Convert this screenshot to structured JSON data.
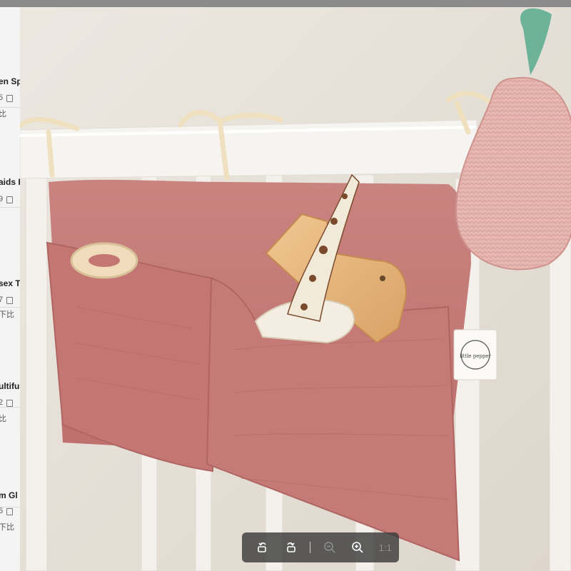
{
  "background_list": {
    "rows": [
      {
        "title": "en Sp",
        "number": "5",
        "compare": "比"
      },
      {
        "title": "aids H",
        "number": "9",
        "compare": "比"
      },
      {
        "title": "sex Tv",
        "number": "7",
        "compare": "下比"
      },
      {
        "title": "ultifu",
        "number": "2",
        "compare": "比"
      },
      {
        "title": "m Gl",
        "number": "5",
        "compare": "下比"
      }
    ]
  },
  "viewer": {
    "image_subject": "crib-hanging-storage-bag",
    "label_tag_text": "little pepper",
    "toolbar": {
      "rotate_left_icon": "rotate-left-icon",
      "rotate_right_icon": "rotate-right-icon",
      "zoom_out_icon": "zoom-out-icon",
      "zoom_in_icon": "zoom-in-icon",
      "actual_size_label": "1:1"
    }
  },
  "colors": {
    "fabric_pink": "#c97b78",
    "crib_white": "#f2efea",
    "wood": "#e3b27a",
    "toolbar_bg": "#3c3c3c"
  }
}
